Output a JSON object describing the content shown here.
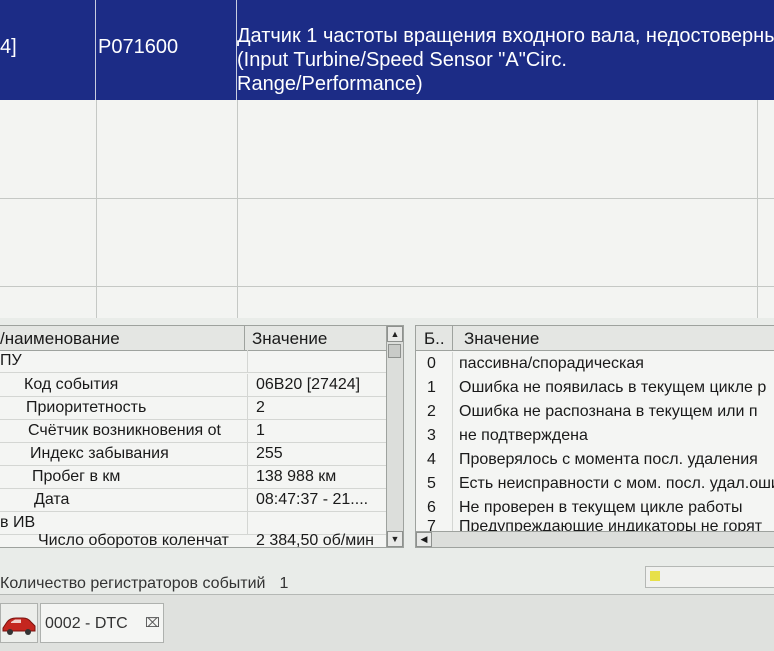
{
  "dtc_table": {
    "selected_row": {
      "col0": "4]",
      "code": "P071600",
      "description": "Датчик 1 частоты вращения входного вала, недостоверный\n(Input Turbine/Speed Sensor \"A\"Circ.\nRange/Performance)"
    }
  },
  "details": {
    "col_name": "/наименование",
    "col_value": "Значение",
    "rows": [
      {
        "name": "ПУ",
        "value": ""
      },
      {
        "name": "Код события",
        "value": "06B20 [27424]"
      },
      {
        "name": "Приоритетность",
        "value": "2"
      },
      {
        "name": "Счётчик возникновения ot",
        "value": "1"
      },
      {
        "name": "Индекс забывания",
        "value": "255"
      },
      {
        "name": "Пробег в км",
        "value": "138 988 км"
      },
      {
        "name": "Дата",
        "value": "08:47:37 - 21...."
      },
      {
        "name": "в ИВ",
        "value": ""
      },
      {
        "name": "Число оборотов коленчат",
        "value": "2 384,50 об/мин"
      }
    ]
  },
  "status_bits": {
    "col_bit": "Б..",
    "col_value": "Значение",
    "rows": [
      {
        "bit": "0",
        "value": "пассивна/спорадическая"
      },
      {
        "bit": "1",
        "value": "Ошибка не появилась в текущем цикле р"
      },
      {
        "bit": "2",
        "value": "Ошибка не распознана в текущем или п"
      },
      {
        "bit": "3",
        "value": "не подтверждена"
      },
      {
        "bit": "4",
        "value": "Проверялось с момента посл. удаления"
      },
      {
        "bit": "5",
        "value": "Есть неисправности с мом. посл. удал.оши"
      },
      {
        "bit": "6",
        "value": "Не проверен в текущем цикле работы"
      },
      {
        "bit": "7",
        "value": "Предупреждающие индикаторы не горят"
      }
    ]
  },
  "status_bar": {
    "label": "Количество регистраторов событий",
    "count": "1"
  },
  "tabs": {
    "dtc_tab": "0002 - DTC",
    "close_glyph": "⌧",
    "car_icon": "car-icon"
  },
  "colors": {
    "selection": "#1c2c86",
    "indicator": "#e7e04a"
  }
}
